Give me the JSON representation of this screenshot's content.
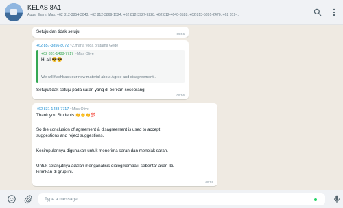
{
  "header": {
    "title": "KELAS 8A1",
    "members": "Agus, Ilham, Mas, +62 812-3854-3043, +62 812-3869-1524, +62 812-3927-9228, +62 812-4640-8528, +62 813-5391-2470, +62 819-..."
  },
  "messages": [
    {
      "text": "Setuju dan tidak setuju",
      "time": "09:56"
    },
    {
      "sender": "+62 857-3856-8072",
      "alias": "~2.marta yoga pratama Gede",
      "quote": {
        "sender": "+62 831-1488-7717",
        "alias": "~Miss Olive",
        "greeting": "Hi all",
        "body": "We will flashback our new material about Agree and disagreement..."
      },
      "text": "Setuju/tidak setuju pada saran yang di berikan seseorang",
      "time": "09:56"
    },
    {
      "sender": "+62 831-1488-7717",
      "alias": "~Miss Olive",
      "lines": [
        "Thank you Students",
        "So the conclusion of agreement & disagreement is used to accept",
        "suggestions and reject suggestions.",
        "Kesimpulannya digunakan untuk menerima saran dan menolak saran.",
        "Untuk selanjutnya adalah menganalisis dialog kembali, sebentar akan ibu",
        "kirimkan di grup ini."
      ],
      "time": "09:59"
    }
  ],
  "composer": {
    "placeholder": "Type a message"
  },
  "icons": {
    "search": "search-icon",
    "menu": "menu-icon",
    "emoji": "emoji-icon",
    "attach": "attach-icon",
    "mic": "mic-icon",
    "scroll": "chevron-down-icon"
  },
  "colors": {
    "chat_bg": "#efeae2",
    "bubble": "#ffffff",
    "quote_accent": "#35a853",
    "sender": "#1f8fd1",
    "online_dot": "#25d366"
  }
}
